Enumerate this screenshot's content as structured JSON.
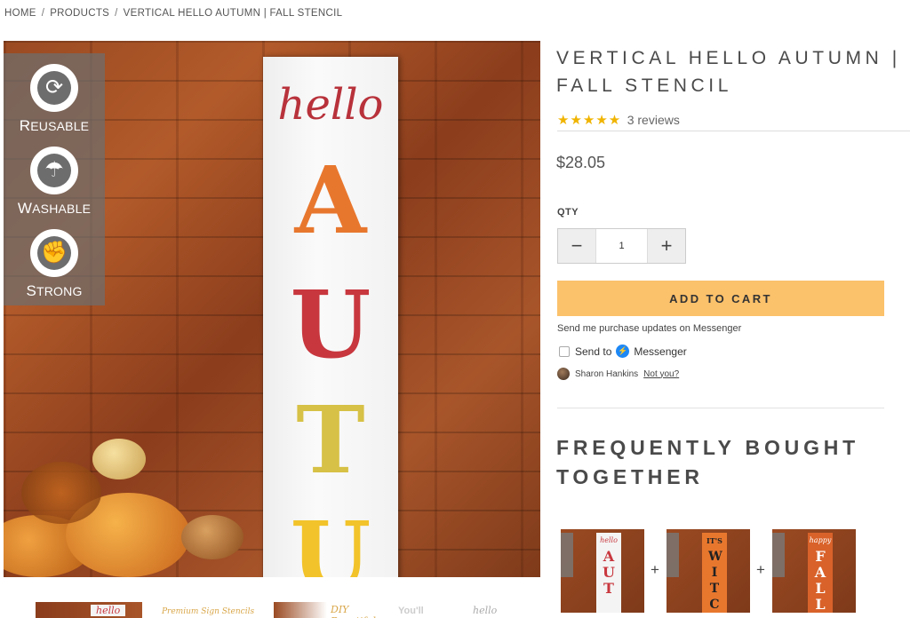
{
  "breadcrumb": {
    "home": "HOME",
    "products": "PRODUCTS",
    "current": "VERTICAL HELLO AUTUMN | FALL STENCIL",
    "separator": "/"
  },
  "image": {
    "badges": [
      {
        "cap": "R",
        "rest": "EUSABLE",
        "icon": "recycle-icon"
      },
      {
        "cap": "W",
        "rest": "ASHABLE",
        "icon": "wash-icon"
      },
      {
        "cap": "S",
        "rest": "TRONG",
        "icon": "muscle-icon"
      }
    ],
    "sign_script": "hello",
    "sign_letters": [
      "A",
      "U",
      "T",
      "U"
    ],
    "sign_letter_colors": [
      "#e8772e",
      "#c8373e",
      "#d7c146",
      "#f2c32a"
    ]
  },
  "thumbnails": [
    "hello",
    "Premium Sign Stencils",
    "DIY Beautiful",
    "You'll",
    "hello"
  ],
  "product": {
    "title": "VERTICAL HELLO AUTUMN | FALL STENCIL",
    "stars": "★★★★★",
    "reviews": "3 reviews",
    "price": "$28.05",
    "qty_label": "QTY",
    "qty_value": "1",
    "minus": "−",
    "plus": "+",
    "add_to_cart": "ADD TO CART"
  },
  "messenger": {
    "note": "Send me purchase updates on Messenger",
    "send_to": "Send to",
    "brand": "Messenger",
    "user": "Sharon Hankins",
    "not_you": "Not you?"
  },
  "fbt": {
    "title": "FREQUENTLY BOUGHT TOGETHER",
    "items": [
      {
        "letters": "AUT",
        "word": "hello"
      },
      {
        "letters": "WITCH",
        "word": "IT'S"
      },
      {
        "letters": "FALL",
        "word": "happy"
      }
    ],
    "plus": "+"
  },
  "colors": {
    "accent": "#fbc16b",
    "star": "#f0b400",
    "messenger": "#1e88f5"
  }
}
